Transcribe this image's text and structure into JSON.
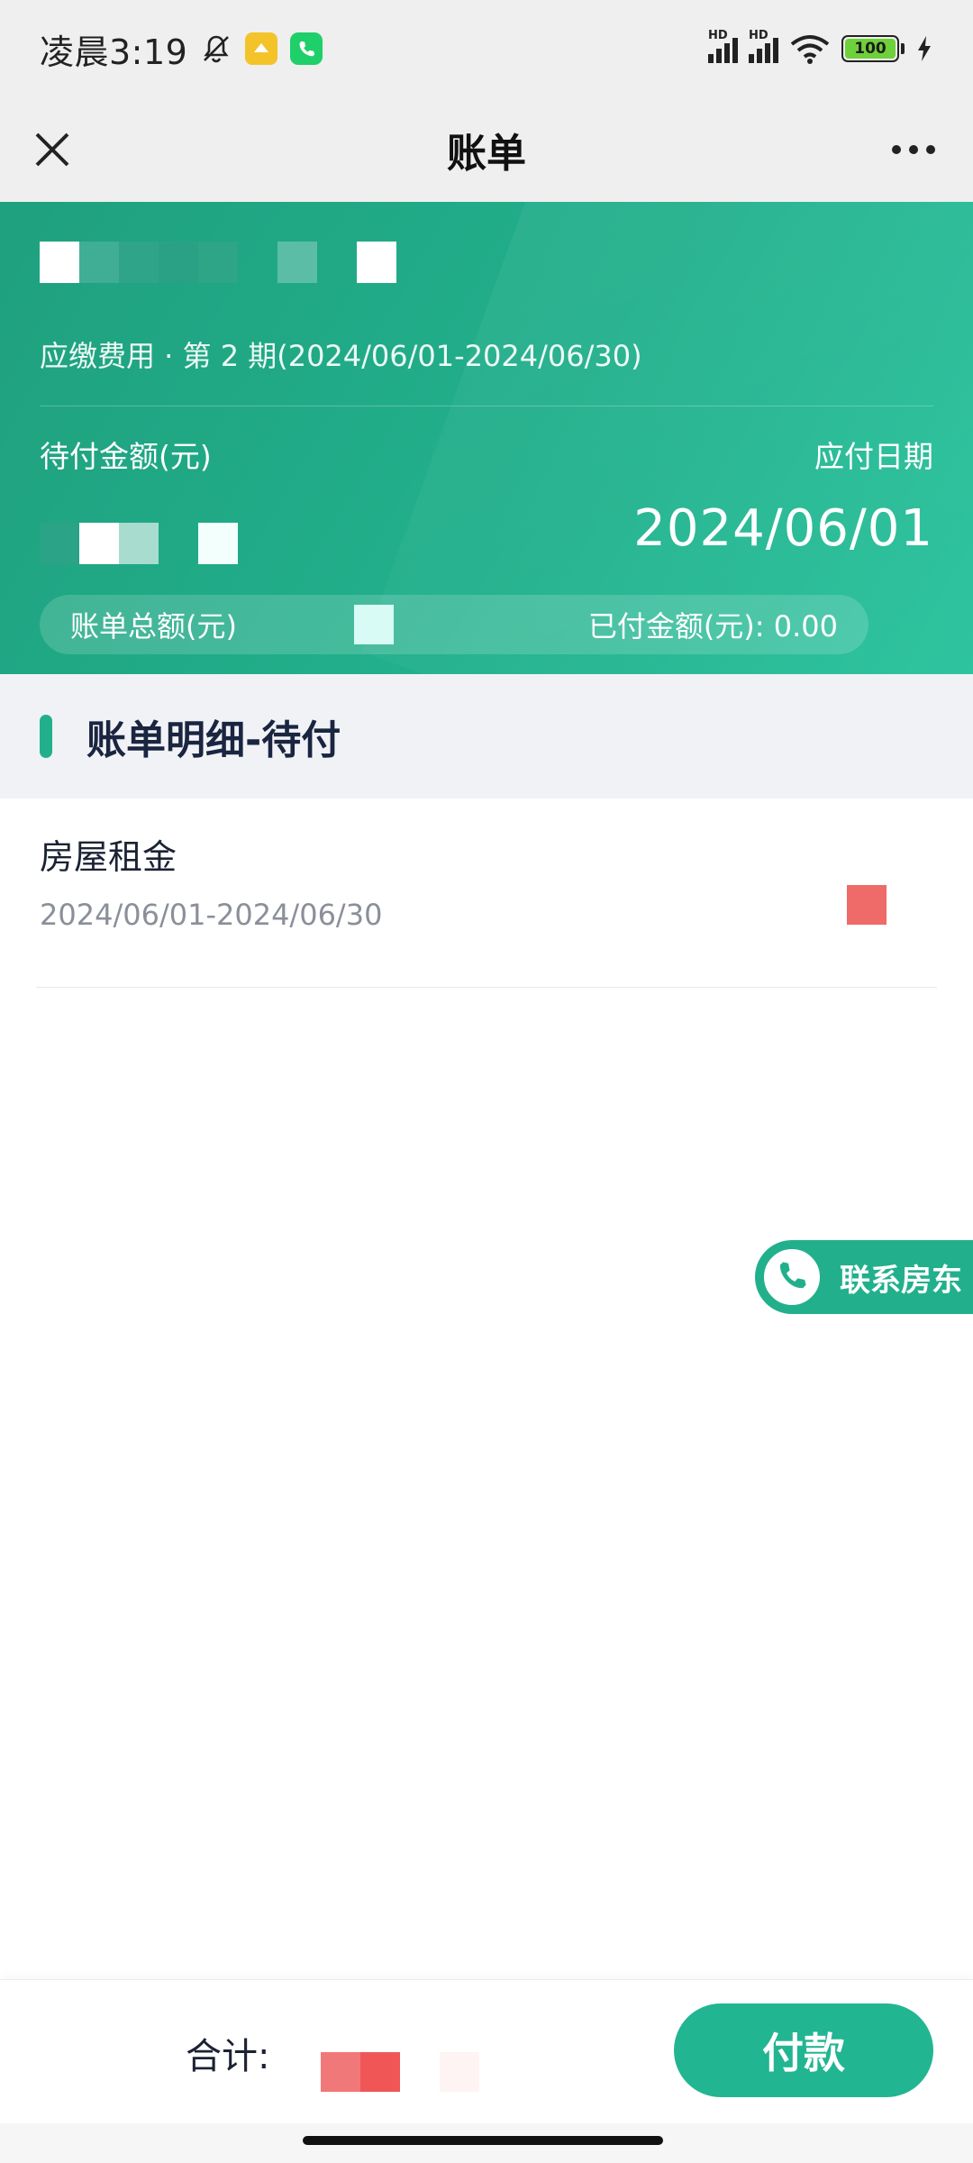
{
  "status_bar": {
    "time": "凌晨3:19",
    "battery": "100",
    "hd1": "HD",
    "hd2": "HD"
  },
  "nav": {
    "title": "账单"
  },
  "bill": {
    "period_text": "应缴费用 · 第 2 期(2024/06/01-2024/06/30)",
    "due_amount_label": "待付金额(元)",
    "due_date_label": "应付日期",
    "due_date": "2024/06/01",
    "total_label": "账单总额(元)",
    "paid_label": "已付金额(元):  0.00"
  },
  "detail": {
    "section_title": "账单明细-待付",
    "items": [
      {
        "name": "房屋租金",
        "period": "2024/06/01-2024/06/30"
      }
    ]
  },
  "contact": {
    "label": "联系房东"
  },
  "footer": {
    "sum_label": "合计:",
    "pay_label": "付款"
  },
  "colors": {
    "brand_green": "#22b08c",
    "amount_red": "#ee6b6a"
  }
}
